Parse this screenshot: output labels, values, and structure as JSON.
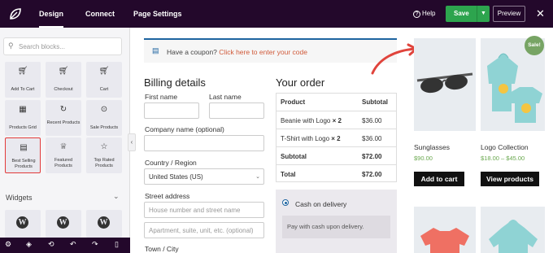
{
  "topbar": {
    "tabs": [
      {
        "label": "Design",
        "active": true
      },
      {
        "label": "Connect",
        "active": false
      },
      {
        "label": "Page Settings",
        "active": false
      }
    ],
    "help_label": "Help",
    "save_label": "Save",
    "preview_label": "Preview"
  },
  "sidebar": {
    "search_placeholder": "Search blocks...",
    "blocks": [
      {
        "label": "Add To Cart",
        "icon": "cart-icon"
      },
      {
        "label": "Checkout",
        "icon": "cart-icon"
      },
      {
        "label": "Cart",
        "icon": "cart-icon"
      },
      {
        "label": "Products Grid",
        "icon": "grid-icon"
      },
      {
        "label": "Recent Products",
        "icon": "refresh-icon"
      },
      {
        "label": "Sale Products",
        "icon": "sale-icon"
      },
      {
        "label": "Best Selling Products",
        "icon": "chart-icon",
        "selected": true
      },
      {
        "label": "Featured Products",
        "icon": "trophy-icon"
      },
      {
        "label": "Top Rated Products",
        "icon": "star-icon"
      }
    ],
    "widgets_title": "Widgets"
  },
  "checkout": {
    "coupon_text": "Have a coupon?",
    "coupon_link": "Click here to enter your code",
    "billing_title": "Billing details",
    "first_name_label": "First name",
    "last_name_label": "Last name",
    "company_label": "Company name (optional)",
    "country_label": "Country / Region",
    "country_value": "United States (US)",
    "street_label": "Street address",
    "street_placeholder": "House number and street name",
    "apartment_placeholder": "Apartment, suite, unit, etc. (optional)",
    "town_label": "Town / City",
    "order_title": "Your order",
    "order_header": {
      "product": "Product",
      "subtotal": "Subtotal"
    },
    "order_items": [
      {
        "product": "Beanie with Logo",
        "qty": "× 2",
        "price": "$36.00"
      },
      {
        "product": "T-Shirt with Logo",
        "qty": "× 2",
        "price": "$36.00"
      }
    ],
    "subtotal_label": "Subtotal",
    "subtotal_value": "$72.00",
    "total_label": "Total",
    "total_value": "$72.00",
    "payment_method": "Cash on delivery",
    "payment_desc": "Pay with cash upon delivery."
  },
  "products": [
    {
      "name": "Sunglasses",
      "price": "$90.00",
      "button": "Add to cart"
    },
    {
      "name": "Logo Collection",
      "price": "$18.00 – $45.00",
      "button": "View products",
      "badge": "Sale!"
    }
  ],
  "colors": {
    "topbar": "#23082b",
    "save": "#2da44e",
    "accent": "#1e64a0",
    "link": "#d05a3a",
    "price": "#6aa84f",
    "arrow": "#e0443c"
  }
}
